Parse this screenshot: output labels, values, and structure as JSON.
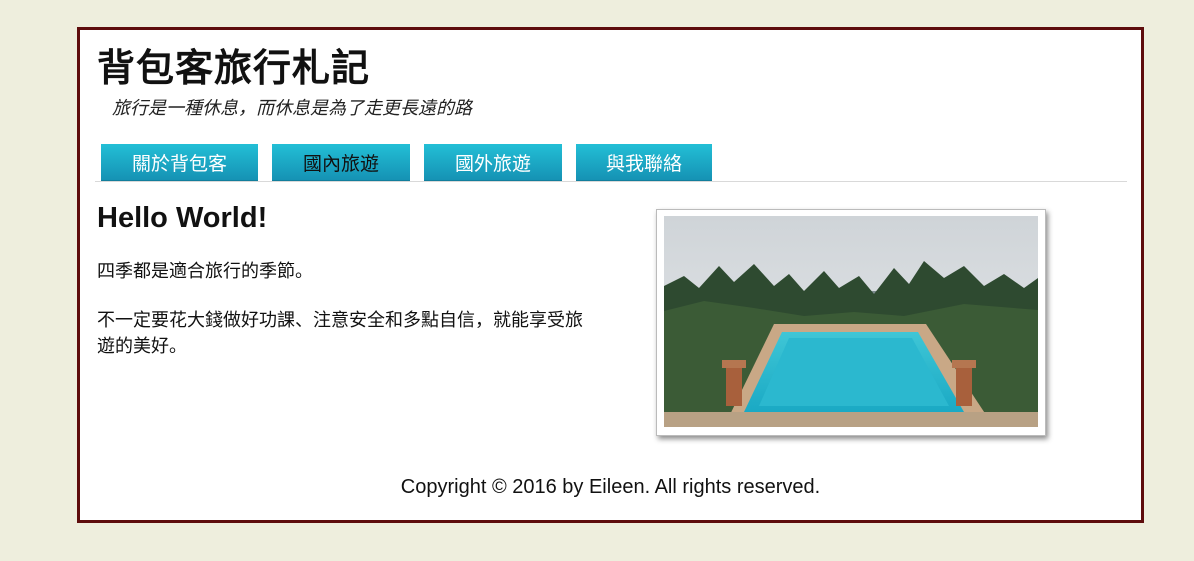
{
  "header": {
    "title": "背包客旅行札記",
    "tagline": "旅行是一種休息，而休息是為了走更長遠的路"
  },
  "nav": {
    "items": [
      {
        "label": "關於背包客"
      },
      {
        "label": "國內旅遊"
      },
      {
        "label": "國外旅遊"
      },
      {
        "label": "與我聯絡"
      }
    ]
  },
  "main": {
    "heading": "Hello World!",
    "paragraph1": "四季都是適合旅行的季節。",
    "paragraph2": "不一定要花大錢做好功課、注意安全和多點自信，就能享受旅遊的美好。"
  },
  "footer": {
    "copyright": "Copyright © 2016 by Eileen. All rights reserved."
  },
  "colors": {
    "page_background": "#eeeedd",
    "frame_border": "#5e0d0d",
    "nav_button_top": "#23bfd6",
    "nav_button_bottom": "#1592b4"
  }
}
